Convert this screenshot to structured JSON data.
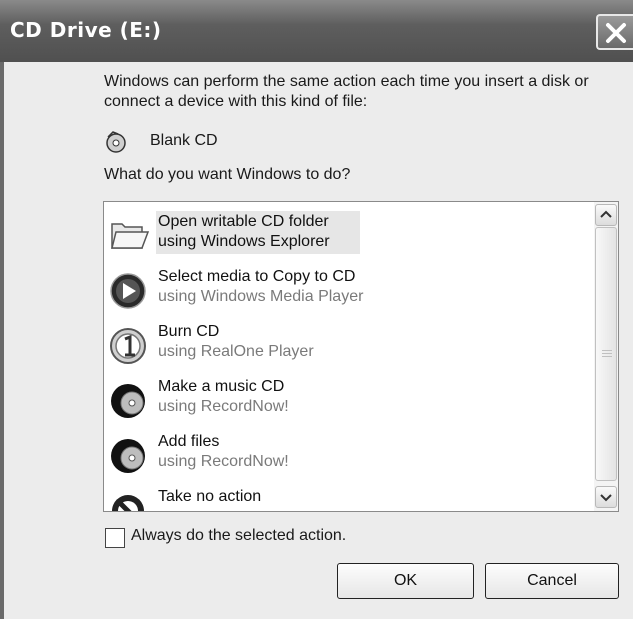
{
  "window": {
    "title": "CD Drive (E:)"
  },
  "dialog": {
    "description": "Windows can perform the same action each time you insert a disk or connect a device with this kind of file:",
    "media_type": "Blank CD",
    "question": "What do you want Windows to do?"
  },
  "actions": [
    {
      "title": "Open writable CD folder",
      "subtitle": "using Windows Explorer",
      "icon": "folder-icon",
      "selected": true
    },
    {
      "title": "Select media to Copy to CD",
      "subtitle": "using Windows Media Player",
      "icon": "media-player-icon"
    },
    {
      "title": "Burn CD",
      "subtitle": "using RealOne Player",
      "icon": "realone-icon"
    },
    {
      "title": "Make a music CD",
      "subtitle": "using RecordNow!",
      "icon": "recordnow-icon"
    },
    {
      "title": "Add files",
      "subtitle": "using RecordNow!",
      "icon": "recordnow-icon"
    },
    {
      "title": "Take no action",
      "subtitle": "",
      "icon": "no-action-icon"
    }
  ],
  "footer": {
    "always_label": "Always do the selected action.",
    "always_checked": false,
    "ok_label": "OK",
    "cancel_label": "Cancel"
  }
}
